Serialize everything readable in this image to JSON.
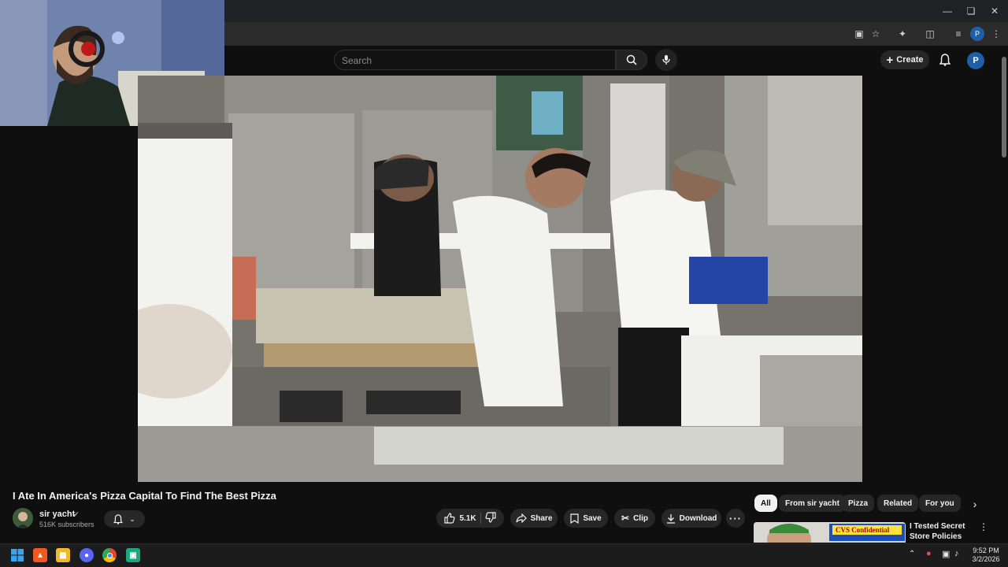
{
  "header": {
    "search_placeholder": "Search",
    "create_label": "Create",
    "avatar_letter": "P"
  },
  "video": {
    "title": "I Ate In America's Pizza Capital To Find The Best Pizza",
    "channel_name": "sir yacht",
    "verified_icon": "check-circle-icon",
    "subscribers": "516K subscribers",
    "likes": "5.1K",
    "share_label": "Share",
    "save_label": "Save",
    "clip_label": "Clip",
    "download_label": "Download"
  },
  "chips": [
    "All",
    "From sir yacht",
    "Pizza",
    "Related",
    "For you"
  ],
  "recommendation": {
    "title": "I Tested Secret Store Policies",
    "thumb_text": "CVS Confidential"
  },
  "taskbar": {
    "time": "9:52 PM",
    "date": "3/2/2026"
  },
  "colors": {
    "background": "#0f0f0f",
    "surface": "#272727",
    "accent_avatar": "#1f5fa8",
    "text": "#f1f1f1"
  }
}
